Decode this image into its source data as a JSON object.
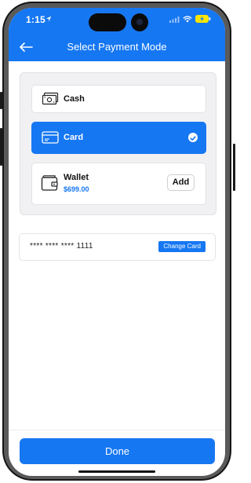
{
  "status_bar": {
    "time": "1:15"
  },
  "header": {
    "title": "Select Payment Mode"
  },
  "payment_options": {
    "cash": {
      "label": "Cash"
    },
    "card": {
      "label": "Card",
      "selected": true
    },
    "wallet": {
      "label": "Wallet",
      "balance": "$699.00",
      "add_label": "Add"
    }
  },
  "saved_card": {
    "masked_number": "**** **** **** 1111",
    "change_label": "Change Card"
  },
  "footer": {
    "done_label": "Done"
  },
  "colors": {
    "accent": "#1677f2",
    "background": "#ffffff",
    "panel": "#f1f1f3"
  }
}
